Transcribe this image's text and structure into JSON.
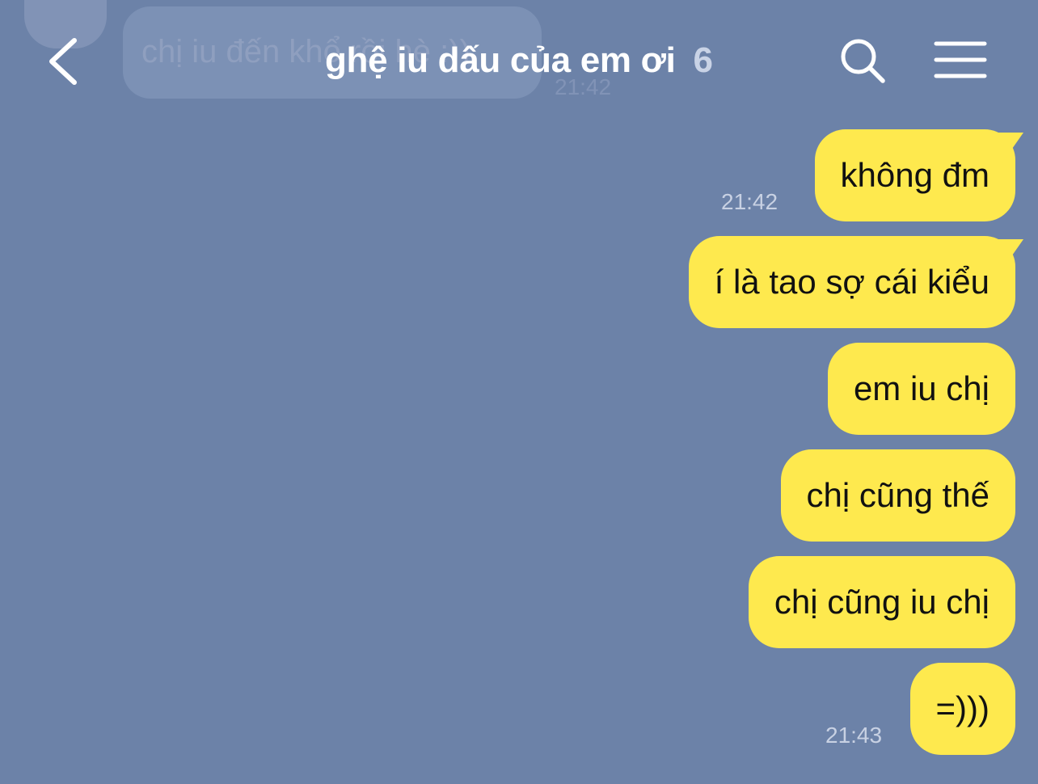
{
  "chat": {
    "title": "ghệ iu dấu của em ơi",
    "member_count": "6",
    "ghost_message": {
      "text": "chị iu đến khổ rồi hè :))",
      "time": "21:42"
    }
  },
  "header": {
    "back_icon": "chevron-left-icon",
    "search_icon": "search-icon",
    "menu_icon": "hamburger-menu-icon"
  },
  "messages": [
    {
      "text": "không đm",
      "time": "21:42"
    },
    {
      "text": "í là tao sợ cái kiểu",
      "time": ""
    },
    {
      "text": "em iu chị",
      "time": ""
    },
    {
      "text": "chị cũng thế",
      "time": ""
    },
    {
      "text": "chị cũng iu chị",
      "time": ""
    },
    {
      "text": "=)))",
      "time": "21:43"
    }
  ],
  "colors": {
    "background": "#6c82a8",
    "bubble": "#fee94e",
    "title": "#ffffff",
    "member_count": "#c9d3e6",
    "timestamp": "#c8d1e3"
  }
}
